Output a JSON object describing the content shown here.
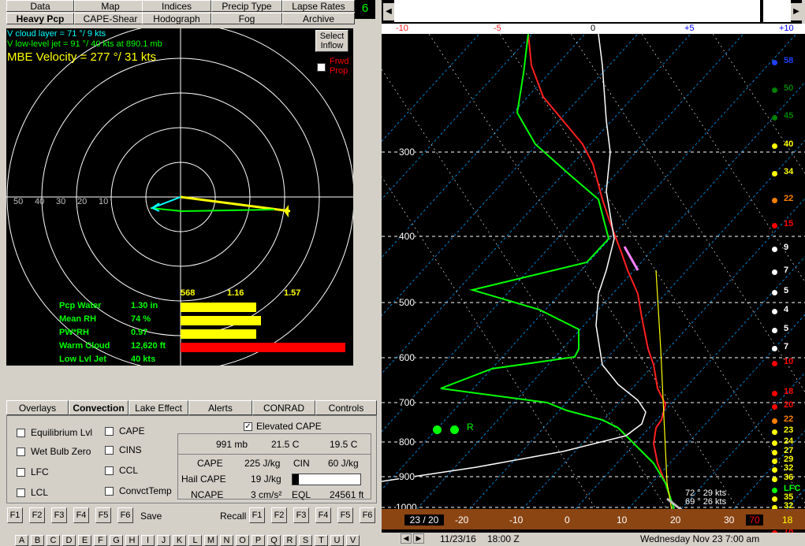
{
  "top_tabs_row1": [
    "Data",
    "Map",
    "Indices",
    "Precip Type",
    "Lapse Rates"
  ],
  "top_tabs_row2": [
    "Heavy Pcp",
    "CAPE-Shear",
    "Hodograph",
    "Fog",
    "Archive"
  ],
  "active_tab": "Heavy Pcp",
  "frame_number": "6",
  "hodo": {
    "cloud_layer": "V cloud layer   =  71 °/ 9 kts",
    "low_level_jet": "V low-level jet =  91 °/ 40 kts at  890.1 mb",
    "mbe_velocity": "MBE Velocity  =  277 °/ 31 kts",
    "select_inflow": [
      "Select",
      "Inflow"
    ],
    "fwd_prop": [
      "Frwd",
      "Prop"
    ],
    "ring_labels": [
      "50",
      "40",
      "30",
      "20",
      "10"
    ],
    "scale_labels": [
      "568",
      "1.16",
      "1.57"
    ],
    "stats": [
      {
        "label": "Pcp Water",
        "value": "1.30 in",
        "frac": 0.46,
        "color": "#ffff00"
      },
      {
        "label": "Mean RH",
        "value": "74 %",
        "frac": 0.49,
        "color": "#ffff00"
      },
      {
        "label": "PW*RH",
        "value": "0.97",
        "frac": 0.46,
        "color": "#ffff00"
      },
      {
        "label": "Warm Cloud",
        "value": "12,620 ft",
        "frac": 1.0,
        "color": "#ff0000"
      },
      {
        "label": "Low Lvl Jet",
        "value": "40 kts",
        "frac": 0,
        "color": "#ffff00"
      }
    ]
  },
  "bottom_tabs": [
    "Overlays",
    "Convection",
    "Lake Effect",
    "Alerts",
    "CONRAD",
    "Controls"
  ],
  "bottom_active": "Convection",
  "checks_col1": [
    "Equilibrium Lvl",
    "Wet Bulb Zero",
    "LFC",
    "LCL"
  ],
  "checks_col2": [
    "CAPE",
    "CINS",
    "CCL",
    "ConvctTemp"
  ],
  "elevated_cape": {
    "label": "Elevated CAPE",
    "checked": true
  },
  "parcel": {
    "pressure": "991 mb",
    "temp": "21.5 C",
    "dew": "19.5 C"
  },
  "cape": {
    "cape_label": "CAPE",
    "cape_val": "225 J/kg",
    "cin_label": "CIN",
    "cin_val": "60 J/kg",
    "hail_label": "Hail CAPE",
    "hail_val": "19 J/kg",
    "ncape_label": "NCAPE",
    "ncape_val": "3 cm/s²",
    "eql_label": "EQL",
    "eql_val": "24561 ft"
  },
  "f_keys": [
    "F1",
    "F2",
    "F3",
    "F4",
    "F5",
    "F6"
  ],
  "save_label": "Save",
  "recall_label": "Recall",
  "letters": [
    "A",
    "B",
    "C",
    "D",
    "E",
    "F",
    "G",
    "H",
    "I",
    "J",
    "K",
    "L",
    "M",
    "N",
    "O",
    "P",
    "Q",
    "R",
    "S",
    "T",
    "U",
    "V"
  ],
  "skewt": {
    "top_axis": [
      {
        "v": "-10",
        "c": "#ff2020"
      },
      {
        "v": "-5",
        "c": "#ff2020"
      },
      {
        "v": "0",
        "c": "#000000"
      },
      {
        "v": "+5",
        "c": "#0000ff"
      },
      {
        "v": "+10",
        "c": "#0000ff"
      }
    ],
    "pressure_labels": [
      "300",
      "400",
      "500",
      "600",
      "700",
      "800",
      "900",
      "1000"
    ],
    "temp_axis": [
      "-20",
      "-10",
      "0",
      "10",
      "20",
      "30"
    ],
    "surface_td": "23 / 20",
    "surface_right": "70",
    "surface_far": "18",
    "storm_motion": [
      "72 ° 29 kts",
      "69 ° 26 kts"
    ],
    "parcel_mark": "R",
    "wind_speeds": [
      {
        "v": "58",
        "c": "#2040ff"
      },
      {
        "v": "50",
        "c": "#008000"
      },
      {
        "v": "45",
        "c": "#008000"
      },
      {
        "v": "40",
        "c": "#ffff00"
      },
      {
        "v": "34",
        "c": "#ffff00"
      },
      {
        "v": "22",
        "c": "#ff8000"
      },
      {
        "v": "15",
        "c": "#ff0000"
      },
      {
        "v": "9",
        "c": "#ffffff"
      },
      {
        "v": "7",
        "c": "#ffffff"
      },
      {
        "v": "5",
        "c": "#ffffff"
      },
      {
        "v": "4",
        "c": "#ffffff"
      },
      {
        "v": "5",
        "c": "#ffffff"
      },
      {
        "v": "7",
        "c": "#ffffff"
      },
      {
        "v": "10",
        "c": "#ff0000"
      },
      {
        "v": "18",
        "c": "#ff0000"
      },
      {
        "v": "20",
        "c": "#ff0000"
      },
      {
        "v": "22",
        "c": "#ff8000"
      },
      {
        "v": "23",
        "c": "#ffff00"
      },
      {
        "v": "24",
        "c": "#ffff00"
      },
      {
        "v": "27",
        "c": "#ffff00"
      },
      {
        "v": "29",
        "c": "#ffff00"
      },
      {
        "v": "32",
        "c": "#ffff00"
      },
      {
        "v": "36",
        "c": "#ffff00"
      },
      {
        "v": "LFC",
        "c": "#00ff00"
      },
      {
        "v": "35",
        "c": "#ffff00"
      },
      {
        "v": "32",
        "c": "#ffff00"
      },
      {
        "v": "28",
        "c": "#ffff00"
      },
      {
        "v": "16",
        "c": "#ff0000"
      },
      {
        "v": "18",
        "c": "#ff0000"
      }
    ]
  },
  "status": {
    "date": "11/23/16",
    "time": "18:00 Z",
    "local": "Wednesday   Nov 23  7:00 am"
  }
}
